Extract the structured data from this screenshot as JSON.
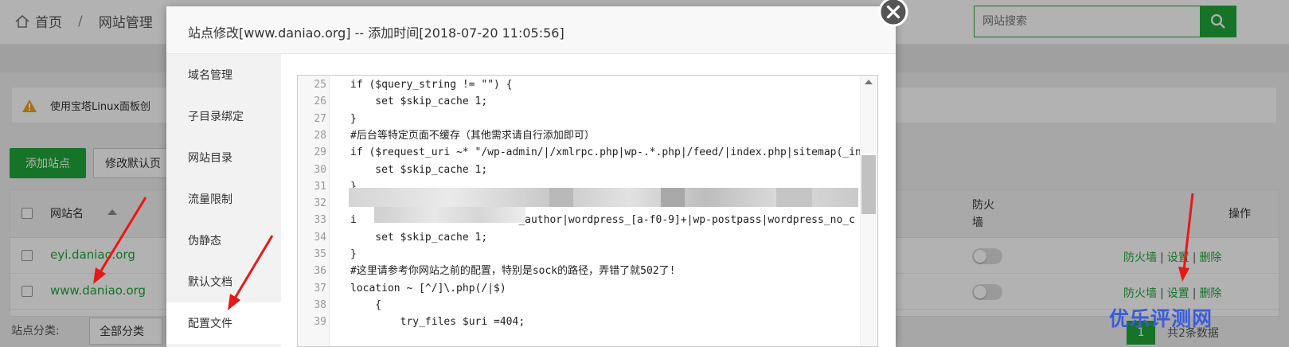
{
  "header": {
    "home_label": "首页",
    "separator": "/",
    "section": "网站管理",
    "search_placeholder": "网站搜索"
  },
  "notice": {
    "text": "使用宝塔Linux面板创"
  },
  "toolbar": {
    "add_site_label": "添加站点",
    "modify_default_label": "修改默认页"
  },
  "table": {
    "col_name": "网站名",
    "col_firewall": "防火墙",
    "col_ops": "操作",
    "rows": [
      {
        "name": "eyi.daniao.org",
        "op_firewall": "防火墙",
        "op_settings": "设置",
        "op_delete": "删除"
      },
      {
        "name": "www.daniao.org",
        "op_firewall": "防火墙",
        "op_settings": "设置",
        "op_delete": "删除"
      }
    ],
    "op_separator": "|"
  },
  "footer": {
    "category_label": "站点分类:",
    "category_value": "全部分类",
    "current_page": "1",
    "total_text": "共2条数据"
  },
  "watermark": "优乐评测网",
  "modal": {
    "title": "站点修改[www.daniao.org] -- 添加时间[2018-07-20 11:05:56]",
    "nav": [
      {
        "label": "域名管理"
      },
      {
        "label": "子目录绑定"
      },
      {
        "label": "网站目录"
      },
      {
        "label": "流量限制"
      },
      {
        "label": "伪静态"
      },
      {
        "label": "默认文档"
      },
      {
        "label": "配置文件",
        "active": true
      }
    ],
    "editor": {
      "lines": [
        {
          "n": "25",
          "text": "if ($query_string != \"\") {"
        },
        {
          "n": "26",
          "text": "    set $skip_cache 1;"
        },
        {
          "n": "27",
          "text": "}"
        },
        {
          "n": "28",
          "text": "#后台等特定页面不缓存（其他需求请自行添加即可）"
        },
        {
          "n": "29",
          "text": "if ($request_uri ~* \"/wp-admin/|/xmlrpc.php|wp-.*.php|/feed/|index.php|sitemap(_in"
        },
        {
          "n": "30",
          "text": "    set $skip_cache 1;"
        },
        {
          "n": "31",
          "text": "}"
        },
        {
          "n": "32",
          "text": ""
        },
        {
          "n": "33",
          "text": "i                          _author|wordpress_[a-f0-9]+|wp-postpass|wordpress_no_c"
        },
        {
          "n": "34",
          "text": "    set $skip_cache 1;"
        },
        {
          "n": "35",
          "text": "}"
        },
        {
          "n": "36",
          "text": "#这里请参考你网站之前的配置，特别是sock的路径，弄错了就502了!"
        },
        {
          "n": "37",
          "text": "location ~ [^/]\\.php(/|$)"
        },
        {
          "n": "38",
          "text": "    {"
        },
        {
          "n": "39",
          "text": "        try_files $uri =404;"
        }
      ]
    }
  },
  "colors": {
    "brand_green": "#20a53a",
    "arrow_red": "#e81818",
    "watermark_blue": "#3b5bdb"
  }
}
